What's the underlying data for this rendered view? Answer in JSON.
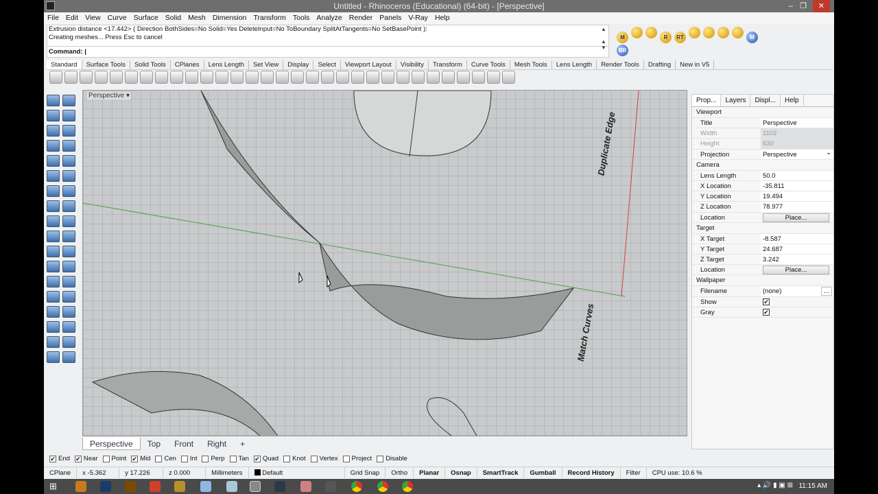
{
  "window": {
    "title": "Untitled - Rhinoceros (Educational) (64-bit) - [Perspective]"
  },
  "menu": [
    "File",
    "Edit",
    "View",
    "Curve",
    "Surface",
    "Solid",
    "Mesh",
    "Dimension",
    "Transform",
    "Tools",
    "Analyze",
    "Render",
    "Panels",
    "V-Ray",
    "Help"
  ],
  "command": {
    "history": [
      "Extrusion distance <17.442> ( Direction  BothSides=No  Solid=Yes  DeleteInput=No  ToBoundary  SplitAtTangents=No  SetBasePoint ):",
      "Creating meshes... Press Esc to cancel"
    ],
    "prompt": "Command:"
  },
  "toolbar_tabs": [
    "Standard",
    "Surface Tools",
    "Solid Tools",
    "CPlanes",
    "Lens Length",
    "Set View",
    "Display",
    "Select",
    "Viewport Layout",
    "Visibility",
    "Transform",
    "Curve Tools",
    "Mesh Tools",
    "Lens Length",
    "Render Tools",
    "Drafting",
    "New in V5"
  ],
  "render_icons": [
    "M",
    "",
    "",
    "R",
    "RT",
    "",
    "",
    "",
    "",
    "M",
    "BR"
  ],
  "viewport": {
    "title": "Perspective",
    "annotations": [
      "Duplicate Edge",
      "Match Curves"
    ]
  },
  "viewport_tabs": [
    "Perspective",
    "Top",
    "Front",
    "Right",
    "+"
  ],
  "panel": {
    "tabs": [
      "Prop...",
      "Layers",
      "Displ...",
      "Help"
    ],
    "sections": [
      {
        "title": "Viewport",
        "rows": [
          {
            "k": "Title",
            "v": "Perspective"
          },
          {
            "k": "Width",
            "v": "1102",
            "disabled": true
          },
          {
            "k": "Height",
            "v": "630",
            "disabled": true
          },
          {
            "k": "Projection",
            "v": "Perspective",
            "dropdown": true
          }
        ]
      },
      {
        "title": "Camera",
        "rows": [
          {
            "k": "Lens Length",
            "v": "50.0"
          },
          {
            "k": "X Location",
            "v": "-35.811"
          },
          {
            "k": "Y Location",
            "v": "19.494"
          },
          {
            "k": "Z Location",
            "v": "78.977"
          },
          {
            "k": "Location",
            "v": "Place...",
            "button": true
          }
        ]
      },
      {
        "title": "Target",
        "rows": [
          {
            "k": "X Target",
            "v": "-8.587"
          },
          {
            "k": "Y Target",
            "v": "24.687"
          },
          {
            "k": "Z Target",
            "v": "3.242"
          },
          {
            "k": "Location",
            "v": "Place...",
            "button": true
          }
        ]
      },
      {
        "title": "Wallpaper",
        "rows": [
          {
            "k": "Filename",
            "v": "(none)",
            "more": "..."
          },
          {
            "k": "Show",
            "check": true
          },
          {
            "k": "Gray",
            "check": true
          }
        ]
      }
    ]
  },
  "osnaps": [
    {
      "l": "End",
      "c": true
    },
    {
      "l": "Near",
      "c": true
    },
    {
      "l": "Point",
      "c": false
    },
    {
      "l": "Mid",
      "c": true
    },
    {
      "l": "Cen",
      "c": false
    },
    {
      "l": "Int",
      "c": false
    },
    {
      "l": "Perp",
      "c": false
    },
    {
      "l": "Tan",
      "c": false
    },
    {
      "l": "Quad",
      "c": true
    },
    {
      "l": "Knot",
      "c": false
    },
    {
      "l": "Vertex",
      "c": false
    },
    {
      "l": "Project",
      "c": false
    },
    {
      "l": "Disable",
      "c": false
    }
  ],
  "status": {
    "cplane": "CPlane",
    "x": "x -5.362",
    "y": "y 17.226",
    "z": "z 0.000",
    "units": "Millimeters",
    "layer": "Default",
    "buttons": [
      {
        "l": "Grid Snap",
        "b": false
      },
      {
        "l": "Ortho",
        "b": false
      },
      {
        "l": "Planar",
        "b": true
      },
      {
        "l": "Osnap",
        "b": true
      },
      {
        "l": "SmartTrack",
        "b": true
      },
      {
        "l": "Gumball",
        "b": true
      },
      {
        "l": "Record History",
        "b": true
      },
      {
        "l": "Filter",
        "b": false
      }
    ],
    "cpu": "CPU use: 10.6 %"
  },
  "taskbar": {
    "clock": "11:15 AM"
  }
}
